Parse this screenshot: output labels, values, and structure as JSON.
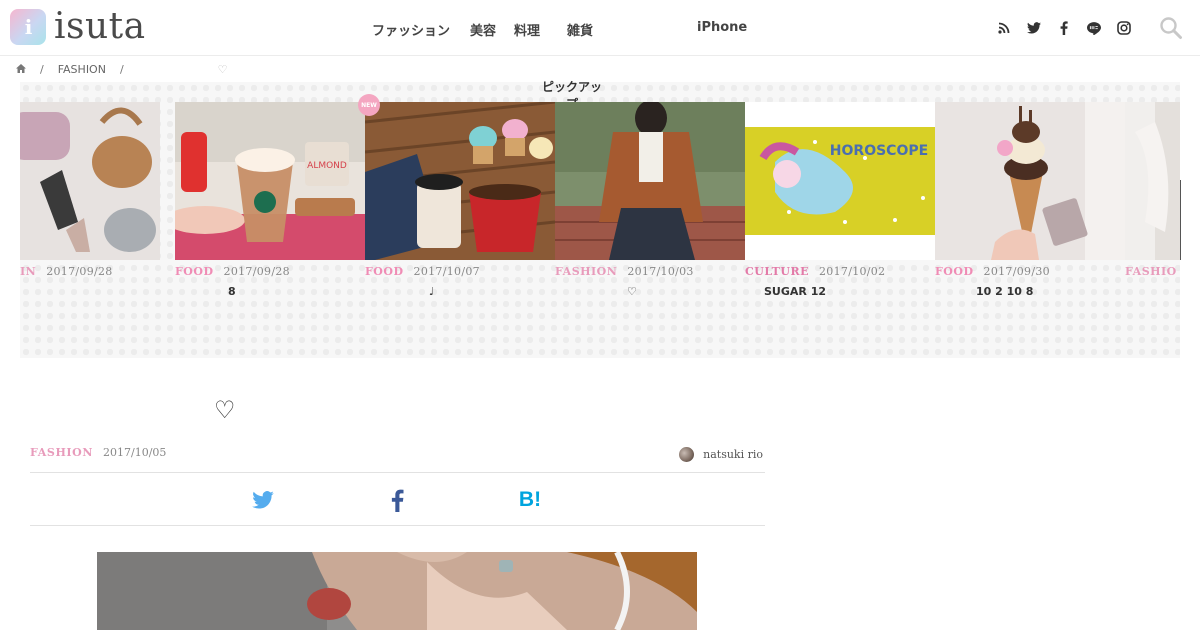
{
  "header": {
    "logo_mark": "i",
    "logo_text": "isuta",
    "nav": [
      {
        "label": "ファッション"
      },
      {
        "label": "美容"
      },
      {
        "label": "料理"
      },
      {
        "label": "雑貨"
      },
      {
        "label": "iPhone"
      }
    ],
    "social_icons": [
      "rss-icon",
      "twitter-icon",
      "facebook-icon",
      "line-icon",
      "instagram-icon"
    ],
    "search_icon": "search-icon"
  },
  "breadcrumb": {
    "home_icon": "home-icon",
    "separator": "/",
    "category": "FASHION",
    "current": "♡"
  },
  "carousel": {
    "title": "ピックアップ",
    "new_badge": "NEW",
    "cards": [
      {
        "category": "IN",
        "date": "2017/09/28",
        "title": "",
        "cat_class": "cat-fashion"
      },
      {
        "category": "FOOD",
        "date": "2017/09/28",
        "title": "8",
        "cat_class": "cat-food"
      },
      {
        "category": "FOOD",
        "date": "2017/10/07",
        "title": "♩",
        "cat_class": "cat-food"
      },
      {
        "category": "FASHION",
        "date": "2017/10/03",
        "title": "♡",
        "cat_class": "cat-fashion"
      },
      {
        "category": "CULTURE",
        "date": "2017/10/02",
        "title": "SUGAR 12",
        "cat_class": "cat-culture"
      },
      {
        "category": "FOOD",
        "date": "2017/09/30",
        "title": "10 2 10 8",
        "cat_class": "cat-food"
      },
      {
        "category": "FASHIO",
        "date": "",
        "title": "",
        "cat_class": "cat-fashion"
      }
    ]
  },
  "article": {
    "title": "♡",
    "category": "FASHION",
    "date": "2017/10/05",
    "author": "natsuki rio",
    "share": [
      "twitter-share-icon",
      "facebook-share-icon",
      "hatena-bookmark-icon"
    ],
    "hatena_label": "B!"
  },
  "colors": {
    "accent_pink": "#e89bbb",
    "twitter_blue": "#55acee",
    "facebook_blue": "#3b5998",
    "hatena_blue": "#00a4de"
  }
}
